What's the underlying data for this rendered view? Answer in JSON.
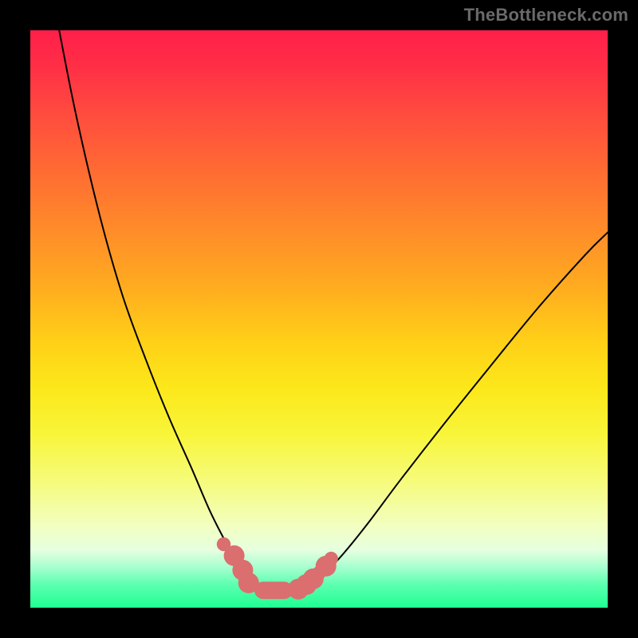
{
  "watermark": "TheBottleneck.com",
  "colors": {
    "frame": "#000000",
    "gradient_top": "#ff1f4a",
    "gradient_bottom": "#1fff92",
    "curve": "#000000",
    "markers": "#db6e6e",
    "watermark": "#6a6a6a"
  },
  "chart_data": {
    "type": "line",
    "title": "",
    "xlabel": "",
    "ylabel": "",
    "xlim": [
      0,
      100
    ],
    "ylim": [
      0,
      100
    ],
    "x": [
      5,
      8,
      12,
      16,
      20,
      24,
      28,
      31,
      33.5,
      35.7,
      37.5,
      39,
      41,
      43.5,
      46,
      49,
      53,
      58,
      64,
      71,
      79,
      88,
      96,
      100
    ],
    "values": [
      100,
      85,
      68,
      54,
      43,
      33,
      24,
      17,
      12,
      8,
      5.5,
      3.5,
      3,
      3,
      3,
      4.5,
      8,
      14,
      22,
      31,
      41,
      52,
      61,
      65
    ],
    "annotations": [
      {
        "type": "marker",
        "x": 33.5,
        "y": 11,
        "r": 1.2
      },
      {
        "type": "marker",
        "x": 35.3,
        "y": 9,
        "r": 1.8
      },
      {
        "type": "marker",
        "x": 36.8,
        "y": 6.5,
        "r": 1.8
      },
      {
        "type": "marker",
        "x": 37.8,
        "y": 4.3,
        "r": 1.8
      },
      {
        "type": "bar",
        "x1": 38.8,
        "x2": 45.5,
        "y": 3.0,
        "h": 3.0
      },
      {
        "type": "marker",
        "x": 46.4,
        "y": 3.2,
        "r": 1.8
      },
      {
        "type": "marker",
        "x": 47.8,
        "y": 4.0,
        "r": 1.8
      },
      {
        "type": "marker",
        "x": 49.0,
        "y": 5.0,
        "r": 1.8
      },
      {
        "type": "marker",
        "x": 50.0,
        "y": 6.0,
        "r": 1.2
      },
      {
        "type": "marker",
        "x": 51.2,
        "y": 7.2,
        "r": 1.8
      },
      {
        "type": "marker",
        "x": 52.1,
        "y": 8.5,
        "r": 1.2
      }
    ]
  }
}
